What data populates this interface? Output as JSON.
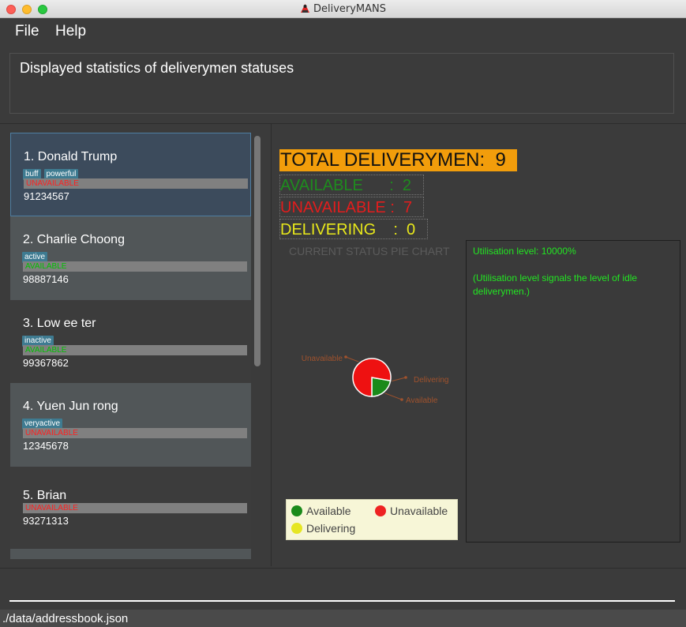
{
  "window": {
    "title": "DeliveryMANS",
    "app_icon": "delivery-app-icon"
  },
  "menu": {
    "items": [
      {
        "label": "File"
      },
      {
        "label": "Help"
      }
    ]
  },
  "result_display": {
    "text": "Displayed statistics of deliverymen statuses"
  },
  "deliverymen": [
    {
      "index_name": "1.  Donald Trump",
      "tags": [
        "buff",
        "powerful"
      ],
      "status": "UNAVAILABLE",
      "phone": "91234567"
    },
    {
      "index_name": "2.  Charlie Choong",
      "tags": [
        "active"
      ],
      "status": "AVAILABLE",
      "phone": "98887146"
    },
    {
      "index_name": "3.  Low ee ter",
      "tags": [
        "inactive"
      ],
      "status": "AVAILABLE",
      "phone": "99367862"
    },
    {
      "index_name": "4.  Yuen Jun rong",
      "tags": [
        "veryactive"
      ],
      "status": "UNAVAILABLE",
      "phone": "12345678"
    },
    {
      "index_name": "5.  Brian",
      "tags": [],
      "status": "UNAVAILABLE",
      "phone": "93271313"
    }
  ],
  "stats": {
    "total": "TOTAL DELIVERYMEN:  9",
    "available": "AVAILABLE      :  2",
    "unavailable": "UNAVAILABLE :  7",
    "delivering": "DELIVERING    :  0"
  },
  "utilisation": {
    "level": "Utilisation level: 10000%",
    "note": "(Utilisation level signals the level of idle deliverymen.)"
  },
  "chart_data": {
    "type": "pie",
    "title": "CURRENT STATUS PIE CHART",
    "slices": [
      {
        "name": "Available",
        "value": 2,
        "color": "#1a8a1a"
      },
      {
        "name": "Unavailable",
        "value": 7,
        "color": "#ee1111"
      },
      {
        "name": "Delivering",
        "value": 0,
        "color": "#e5e51a"
      }
    ],
    "legend": [
      {
        "label": "Available",
        "color": "#1a8a1a"
      },
      {
        "label": "Unavailable",
        "color": "#ee2222"
      },
      {
        "label": "Delivering",
        "color": "#e6e622"
      }
    ],
    "legend_position": "bottom",
    "label_color": "#a0522d"
  },
  "command_box": {
    "value": ""
  },
  "status_bar": {
    "path": "./data/addressbook.json"
  }
}
